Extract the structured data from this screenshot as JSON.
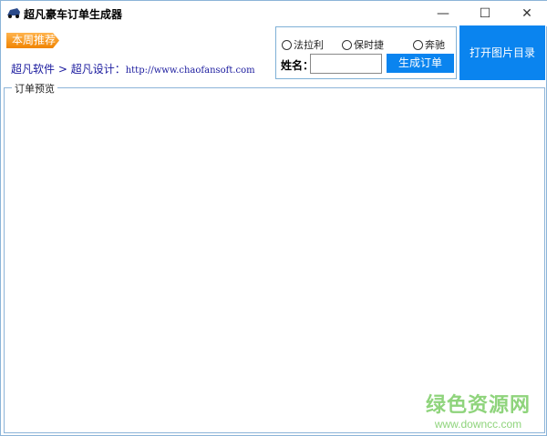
{
  "window": {
    "title": "超凡豪车订单生成器",
    "minimize": "—",
    "maximize": "☐",
    "close": "✕"
  },
  "badge": "本周推荐",
  "links": {
    "company": "超凡软件",
    "separator": " > ",
    "design": "超凡设计：",
    "url": "http://www.chaofansoft.com"
  },
  "options": [
    "法拉利",
    "保时捷",
    "奔驰"
  ],
  "name_label": "姓名：",
  "name_value": "",
  "generate_button": "生成订单",
  "open_button": "打开图片目录",
  "preview_label": "订单预览",
  "watermark": {
    "title": "绿色资源网",
    "url": "www.downcc.com"
  }
}
